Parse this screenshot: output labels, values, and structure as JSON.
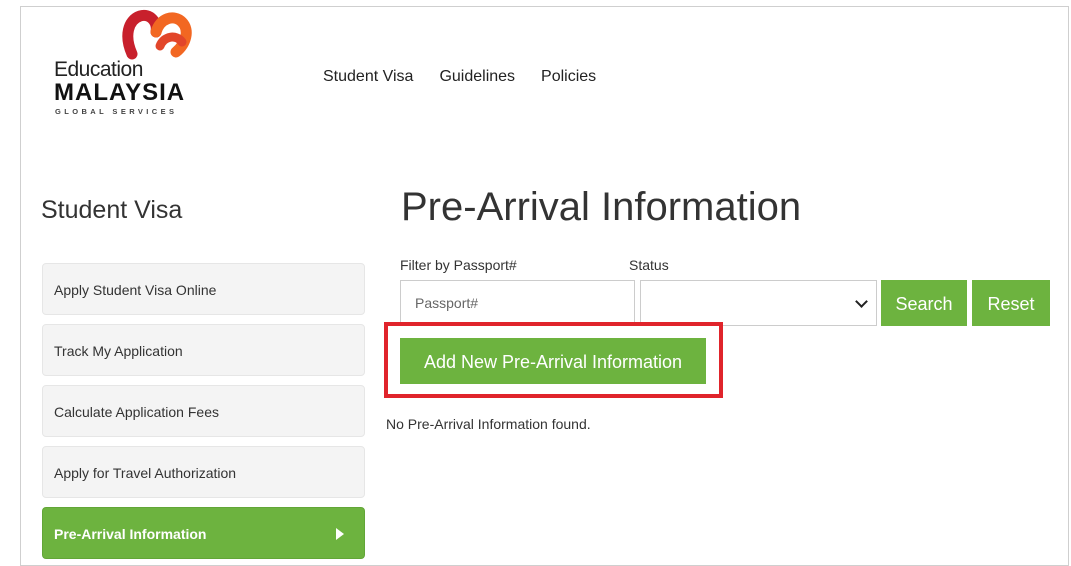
{
  "logo": {
    "line1": "Education",
    "line2": "MALAYSIA",
    "line3": "GLOBAL SERVICES",
    "mark_colors": [
      "#c8202c",
      "#f26722"
    ]
  },
  "topnav": {
    "items": [
      {
        "label": "Student Visa"
      },
      {
        "label": "Guidelines"
      },
      {
        "label": "Policies"
      }
    ]
  },
  "sidebar": {
    "title": "Student Visa",
    "items": [
      {
        "label": "Apply Student Visa Online",
        "active": false
      },
      {
        "label": "Track My Application",
        "active": false
      },
      {
        "label": "Calculate Application Fees",
        "active": false
      },
      {
        "label": "Apply for Travel Authorization",
        "active": false
      },
      {
        "label": "Pre-Arrival Information",
        "active": true,
        "icon": "caret-right-icon"
      }
    ]
  },
  "main": {
    "title": "Pre-Arrival Information",
    "filter": {
      "passport_label": "Filter by Passport#",
      "passport_placeholder": "Passport#",
      "passport_value": "",
      "status_label": "Status",
      "status_value": ""
    },
    "search_label": "Search",
    "reset_label": "Reset",
    "add_label": "Add New Pre-Arrival Information",
    "empty_message": "No Pre-Arrival Information found."
  },
  "colors": {
    "accent_green": "#6db33f",
    "highlight_red": "#e0242b"
  }
}
